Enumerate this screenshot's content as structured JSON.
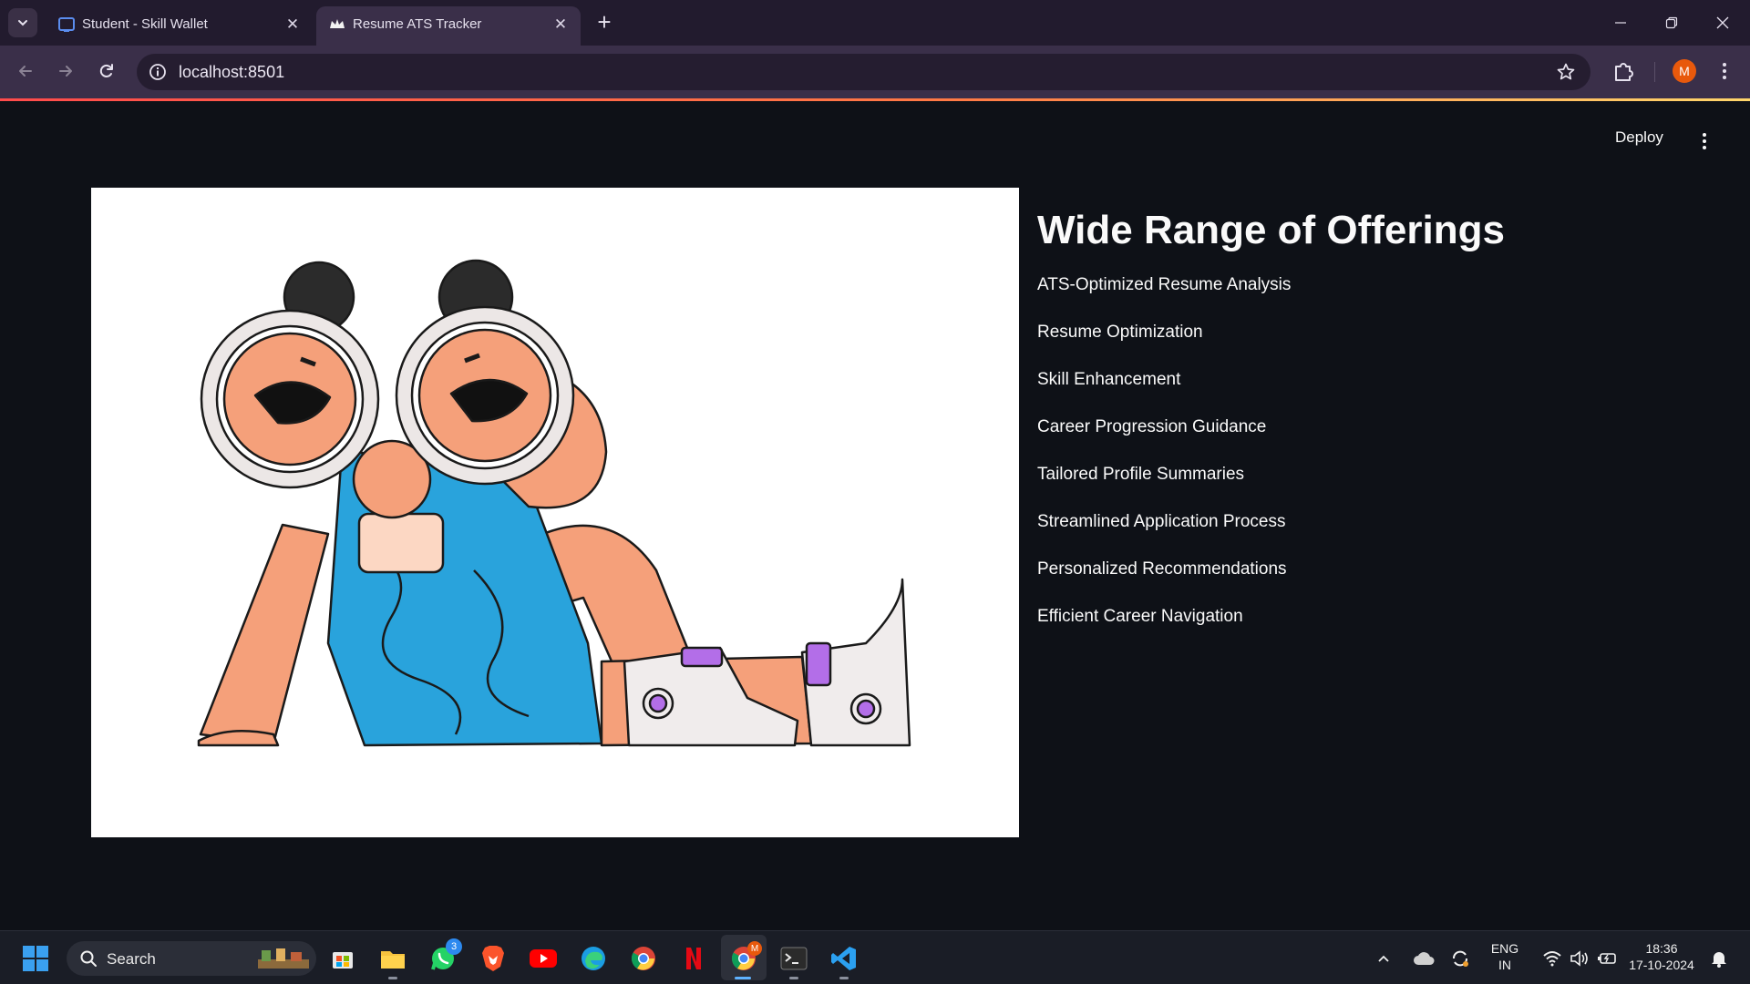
{
  "browser": {
    "tabs": [
      {
        "title": "Student - Skill Wallet",
        "active": false
      },
      {
        "title": "Resume ATS Tracker",
        "active": true
      }
    ],
    "address": "localhost:8501",
    "profile_initial": "M"
  },
  "app": {
    "deploy_label": "Deploy",
    "heading": "Wide Range of Offerings",
    "offerings": [
      "ATS-Optimized Resume Analysis",
      "Resume Optimization",
      "Skill Enhancement",
      "Career Progression Guidance",
      "Tailored Profile Summaries",
      "Streamlined Application Process",
      "Personalized Recommendations",
      "Efficient Career Navigation"
    ]
  },
  "taskbar": {
    "search_label": "Search",
    "whatsapp_badge": "3",
    "chrome_profile_badge": "M",
    "language_line1": "ENG",
    "language_line2": "IN",
    "time": "18:36",
    "date": "17-10-2024"
  },
  "colors": {
    "page_background": "#0e1117",
    "accent_gradient_start": "#ff4b4b",
    "profile_orange": "#e8590c"
  }
}
